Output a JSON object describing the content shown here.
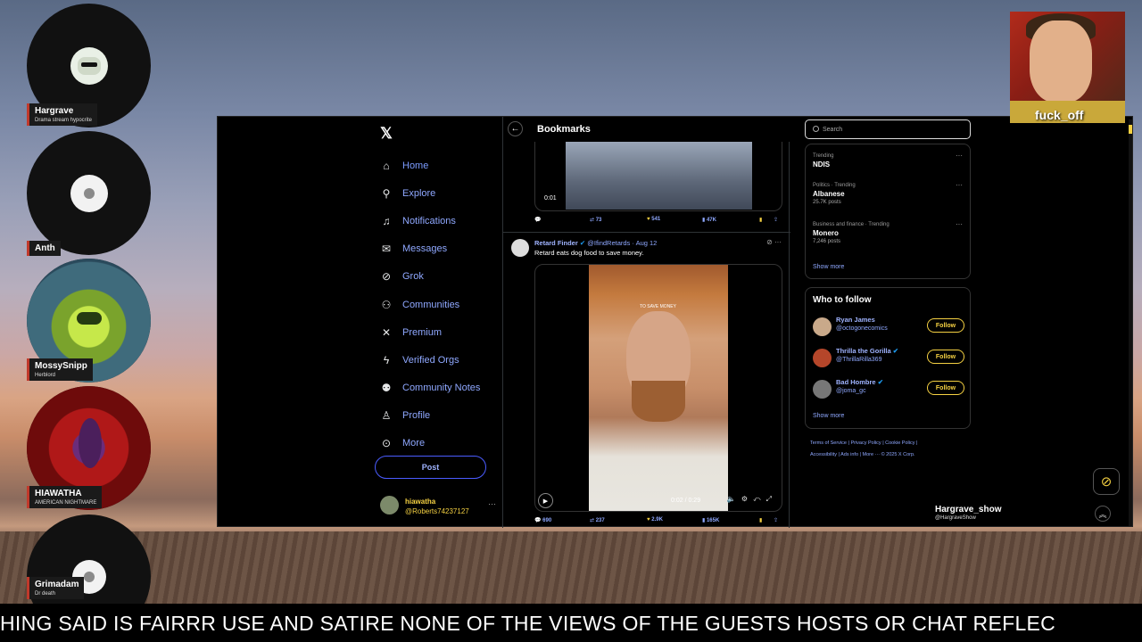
{
  "guests": [
    {
      "name": "Hargrave",
      "subtitle": "Drama stream hypocrite"
    },
    {
      "name": "Anth",
      "subtitle": ""
    },
    {
      "name": "MossySnipp",
      "subtitle": "Herblord"
    },
    {
      "name": "HIAWATHA",
      "subtitle": "AMERICAN NIGHTMARE"
    },
    {
      "name": "Grimadam",
      "subtitle": "Dr death"
    }
  ],
  "logo": "𝕏",
  "nav": {
    "items": [
      {
        "label": "Home",
        "icon": "home-icon",
        "glyph": "⌂"
      },
      {
        "label": "Explore",
        "icon": "search-icon",
        "glyph": "⚲"
      },
      {
        "label": "Notifications",
        "icon": "bell-icon",
        "glyph": "♫"
      },
      {
        "label": "Messages",
        "icon": "mail-icon",
        "glyph": "✉"
      },
      {
        "label": "Grok",
        "icon": "grok-icon",
        "glyph": "⊘"
      },
      {
        "label": "Communities",
        "icon": "communities-icon",
        "glyph": "⚇"
      },
      {
        "label": "Premium",
        "icon": "x-premium-icon",
        "glyph": "✕"
      },
      {
        "label": "Verified Orgs",
        "icon": "lightning-icon",
        "glyph": "ϟ"
      },
      {
        "label": "Community Notes",
        "icon": "notes-icon",
        "glyph": "⚉"
      },
      {
        "label": "Profile",
        "icon": "profile-icon",
        "glyph": "♙"
      },
      {
        "label": "More",
        "icon": "more-icon",
        "glyph": "⊙"
      }
    ],
    "post_label": "Post",
    "account": {
      "display_name": "hiawatha",
      "handle": "@Roberts74237127",
      "more": "···"
    }
  },
  "feed": {
    "title": "Bookmarks",
    "back_glyph": "←",
    "top_post": {
      "timestamp": "0:01",
      "actions": {
        "replies": "",
        "reposts": "73",
        "likes": "541",
        "views": "47K"
      }
    },
    "post": {
      "author": "Retard Finder",
      "handle": "@IfindRetards",
      "date": "· Aug 12",
      "text": "Retard eats dog food to save money.",
      "video_caption": "TO SAVE MONEY",
      "video_time": "0:02 / 0:29",
      "actions": {
        "replies": "690",
        "reposts": "237",
        "likes": "2.9K",
        "views": "165K"
      }
    }
  },
  "right": {
    "search_placeholder": "Search",
    "trends": [
      {
        "context": "Trending",
        "topic": "NDIS",
        "count": ""
      },
      {
        "context": "Politics · Trending",
        "topic": "Albanese",
        "count": "25.7K posts"
      },
      {
        "context": "Business and finance · Trending",
        "topic": "Monero",
        "count": "7,246 posts"
      }
    ],
    "trends_show_more": "Show more",
    "who_to_follow": {
      "title": "Who to follow",
      "users": [
        {
          "name": "Ryan James",
          "handle": "@octogonecomics",
          "follow": "Follow"
        },
        {
          "name": "Thrilla the Gorilla",
          "handle": "@ThrillaRilla369",
          "follow": "Follow"
        },
        {
          "name": "Bad Hombre",
          "handle": "@joma_gc",
          "follow": "Follow"
        }
      ],
      "show_more": "Show more"
    },
    "footer": {
      "line1": "Terms of Service  |  Privacy Policy  |  Cookie Policy  |",
      "line2": "Accessibility  |  Ads info  |  More ···  © 2025 X Corp."
    }
  },
  "overlay": {
    "host_name": "Hargrave_show",
    "host_handle": "@HargraveShow",
    "meme_caption": "fuck_off",
    "ticker": "HING SAID IS FAIRRR USE AND SATIRE NONE OF THE VIEWS OF THE GUESTS HOSTS OR CHAT REFLEC"
  },
  "colors": {
    "accent": "#8fa8ff",
    "follow": "#f5d142",
    "background": "#000000"
  }
}
